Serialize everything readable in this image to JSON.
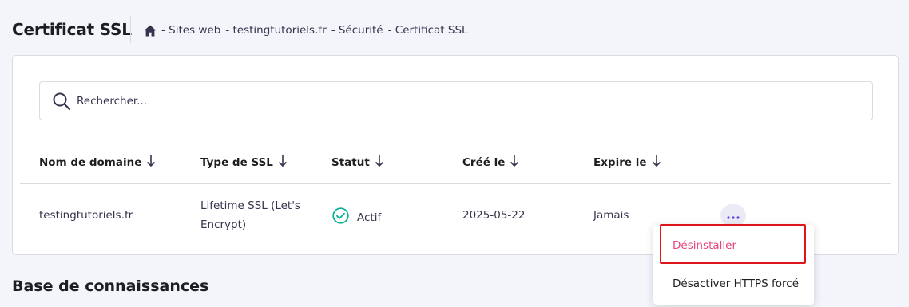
{
  "header": {
    "title": "Certificat SSL",
    "breadcrumb": {
      "icon": "home-icon",
      "items": [
        "- Sites web",
        "- testingtutoriels.fr",
        "- Sécurité",
        "- Certificat SSL"
      ]
    }
  },
  "search": {
    "placeholder": "Rechercher...",
    "value": "",
    "icon": "search-icon"
  },
  "table": {
    "columns": [
      {
        "label": "Nom de domaine",
        "sort_icon": "arrow-down-icon"
      },
      {
        "label": "Type de SSL",
        "sort_icon": "arrow-down-icon"
      },
      {
        "label": "Statut",
        "sort_icon": "arrow-down-icon"
      },
      {
        "label": "Créé le",
        "sort_icon": "arrow-down-icon"
      },
      {
        "label": "Expire le",
        "sort_icon": "arrow-down-icon"
      }
    ],
    "rows": [
      {
        "domain": "testingtutoriels.fr",
        "ssl_type_line1": "Lifetime SSL (Let's",
        "ssl_type_line2": "Encrypt)",
        "status": "Actif",
        "status_icon": "check-circle-icon",
        "created": "2025-05-22",
        "expires": "Jamais",
        "actions_icon": "more-horizontal-icon"
      }
    ]
  },
  "dropdown": {
    "items": [
      {
        "label": "Désinstaller",
        "highlighted": true
      },
      {
        "label": "Désactiver HTTPS forcé",
        "highlighted": false
      }
    ]
  },
  "knowledge_base": {
    "title": "Base de connaissances"
  },
  "colors": {
    "page_bg": "#f4f4fb",
    "card_bg": "#ffffff",
    "accent": "#673de6",
    "success": "#00b090",
    "danger_text": "#e6457a",
    "highlight_border": "#e0151c"
  }
}
